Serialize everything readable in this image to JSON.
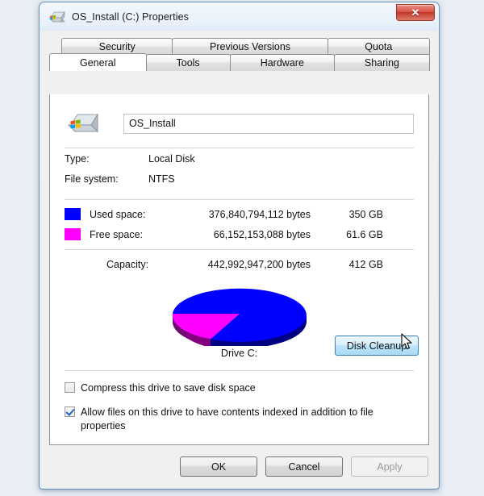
{
  "window": {
    "title": "OS_Install (C:) Properties",
    "title_icon": "hard-drive-icon",
    "close_label": "✕"
  },
  "tabs": {
    "row1": [
      {
        "label": "Security",
        "active": false
      },
      {
        "label": "Previous Versions",
        "active": false
      },
      {
        "label": "Quota",
        "active": false
      }
    ],
    "row2": [
      {
        "label": "General",
        "active": true
      },
      {
        "label": "Tools",
        "active": false
      },
      {
        "label": "Hardware",
        "active": false
      },
      {
        "label": "Sharing",
        "active": false
      }
    ]
  },
  "general": {
    "drive_icon": "hard-drive-icon",
    "volume_label_value": "OS_Install",
    "volume_label_placeholder": "",
    "type_label": "Type:",
    "type_value": "Local Disk",
    "filesystem_label": "File system:",
    "filesystem_value": "NTFS",
    "used_label": "Used space:",
    "used_bytes": "376,840,794,112 bytes",
    "used_gb": "350 GB",
    "used_color": "#0000ff",
    "free_label": "Free space:",
    "free_bytes": "66,152,153,088 bytes",
    "free_gb": "61.6 GB",
    "free_color": "#ff00ff",
    "capacity_label": "Capacity:",
    "capacity_bytes": "442,992,947,200 bytes",
    "capacity_gb": "412 GB",
    "drive_caption": "Drive C:",
    "cleanup_button": "Disk Cleanup",
    "compress_checkbox_label": "Compress this drive to save disk space",
    "compress_checked": false,
    "index_checkbox_label": "Allow files on this drive to have contents indexed in addition to file properties",
    "index_checked": true
  },
  "chart_data": {
    "type": "pie",
    "title": "Drive C:",
    "labels": [
      "Used space",
      "Free space"
    ],
    "values": [
      376840794112,
      66152153088
    ],
    "display_values": [
      "350 GB",
      "61.6 GB"
    ],
    "percentages": [
      85.07,
      14.93
    ],
    "colors": [
      "#0000ff",
      "#ff00ff"
    ],
    "side_colors": [
      "#000080",
      "#800080"
    ],
    "style": "3d-pie",
    "legend": "left-swatches",
    "total_bytes": 442992947200,
    "total_display": "412 GB"
  },
  "footer": {
    "ok_label": "OK",
    "cancel_label": "Cancel",
    "apply_label": "Apply",
    "apply_disabled": true
  },
  "cursor": {
    "name": "arrow-cursor"
  }
}
